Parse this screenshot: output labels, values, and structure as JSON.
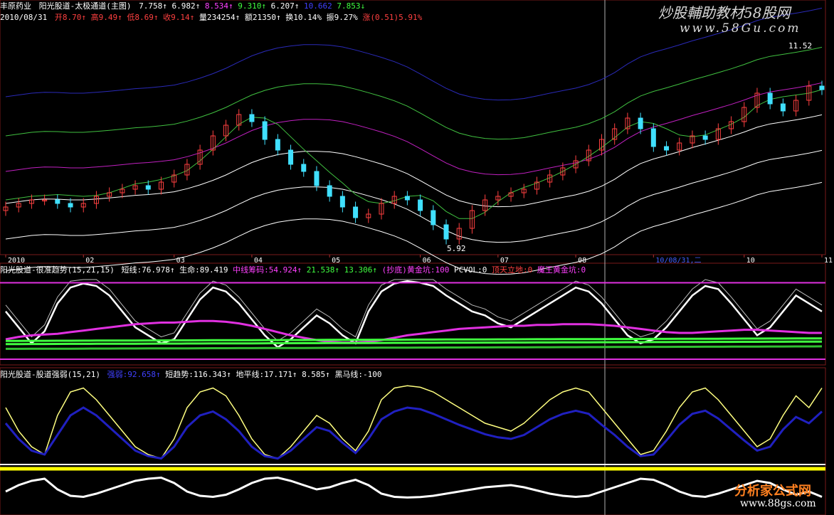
{
  "main_panel": {
    "stock_name": "丰原药业",
    "indicator_name": "阳光股道-太极通道(主图)",
    "indicator_values": [
      "7.758↑",
      "6.982↑",
      "8.534↑",
      "9.310↑",
      "6.207↑",
      "10.662",
      "7.853↓"
    ],
    "date_label": "2010/08/31",
    "ohlc": {
      "open": "开8.70↑",
      "high": "高9.49↑",
      "low": "低8.69↑",
      "close": "收9.14↑",
      "volume": "量234254↑",
      "amount": "额21350↑",
      "turnover": "换10.14%",
      "amplitude": "振9.27%",
      "change": "涨(0.51)5.91%"
    },
    "price_high_label": "11.52",
    "price_low_label": "5.92",
    "colors": {
      "up": "#ff4040",
      "down": "#40e0ff",
      "band_outer": "#2a2ab8",
      "band_mid": "#c020c0",
      "band_green": "#40c040",
      "band_white": "#ffffff"
    }
  },
  "time_axis": {
    "labels": [
      "2010",
      "02",
      "03",
      "04",
      "05",
      "06",
      "07",
      "08",
      "10/08/31,二",
      "10",
      "11"
    ]
  },
  "sub_panel_1": {
    "title": "阳光股道-很准趋势(15,21,15)",
    "items": [
      {
        "text": "短线:76.978↑",
        "color": "#ffffff"
      },
      {
        "text": "生命:89.419",
        "color": "#ffffff"
      },
      {
        "text": "中线筹码:54.924↑",
        "color": "#ff40ff"
      },
      {
        "text": "21.538↑",
        "color": "#40ff40"
      },
      {
        "text": "13.306↑",
        "color": "#40ff40"
      },
      {
        "text": "(抄底)黄金坑:100",
        "color": "#ff40ff"
      },
      {
        "text": "PCVOL:0",
        "color": "#ffffff"
      },
      {
        "text": "顶天立地:0",
        "color": "#ff4040"
      },
      {
        "text": "魔王黄金坑:0",
        "color": "#ff40ff"
      }
    ]
  },
  "sub_panel_2": {
    "title": "阳光股道-股道强弱(15,21)",
    "items": [
      {
        "text": "强弱:92.658↑",
        "color": "#4040ff"
      },
      {
        "text": "短趋势:116.343↑",
        "color": "#ffffff"
      },
      {
        "text": "地平线:17.171↑",
        "color": "#ffffff"
      },
      {
        "text": "8.585↑",
        "color": "#ffffff"
      },
      {
        "text": "黑马线:-100",
        "color": "#ffffff"
      }
    ]
  },
  "watermark": {
    "top_title": "炒股輔助教材58股网",
    "top_url": "www.58Gu.com",
    "bottom_brand": "分析家公式网",
    "bottom_url": "www.88gs.com"
  },
  "chart_data": {
    "type": "line",
    "approximate": true,
    "price_closes": [
      6.9,
      7.0,
      7.1,
      7.1,
      7.0,
      6.9,
      7.0,
      7.2,
      7.3,
      7.4,
      7.5,
      7.4,
      7.6,
      7.8,
      8.1,
      8.5,
      8.9,
      9.2,
      9.5,
      9.3,
      8.8,
      8.5,
      8.1,
      7.9,
      7.5,
      7.2,
      6.9,
      6.6,
      6.7,
      7.0,
      7.2,
      7.1,
      6.8,
      6.4,
      6.0,
      6.3,
      6.8,
      7.1,
      7.2,
      7.3,
      7.4,
      7.6,
      7.8,
      8.0,
      8.2,
      8.5,
      8.8,
      9.1,
      9.4,
      9.1,
      8.6,
      8.5,
      8.7,
      8.9,
      8.8,
      9.1,
      9.3,
      9.7,
      10.1,
      9.8,
      9.6,
      9.9,
      10.3,
      10.2
    ],
    "price_range": [
      5.92,
      11.52
    ],
    "sub1_short_line": [
      60,
      40,
      20,
      35,
      70,
      90,
      95,
      92,
      80,
      60,
      40,
      30,
      20,
      25,
      50,
      75,
      90,
      85,
      70,
      50,
      30,
      15,
      25,
      40,
      55,
      45,
      30,
      20,
      60,
      85,
      95,
      98,
      96,
      92,
      80,
      70,
      60,
      55,
      45,
      40,
      50,
      60,
      70,
      80,
      90,
      85,
      70,
      50,
      30,
      20,
      25,
      40,
      60,
      80,
      92,
      88,
      70,
      50,
      30,
      40,
      60,
      80,
      70,
      60
    ],
    "sub1_life_line": [
      25,
      28,
      30,
      31,
      32,
      34,
      36,
      38,
      40,
      42,
      44,
      45,
      46,
      46,
      47,
      48,
      48,
      47,
      45,
      42,
      38,
      34,
      30,
      27,
      24,
      22,
      21,
      21,
      22,
      24,
      27,
      30,
      32,
      34,
      36,
      38,
      39,
      40,
      41,
      42,
      42,
      43,
      43,
      44,
      44,
      44,
      43,
      42,
      40,
      38,
      36,
      34,
      33,
      33,
      34,
      35,
      36,
      37,
      37,
      36,
      35,
      34,
      33,
      33
    ],
    "sub2_yellow_line": [
      70,
      40,
      20,
      10,
      60,
      90,
      95,
      80,
      60,
      40,
      20,
      10,
      5,
      30,
      70,
      90,
      95,
      85,
      60,
      30,
      10,
      5,
      20,
      40,
      60,
      50,
      30,
      15,
      40,
      80,
      95,
      98,
      96,
      90,
      80,
      70,
      60,
      50,
      45,
      40,
      50,
      65,
      80,
      90,
      95,
      90,
      70,
      50,
      30,
      10,
      15,
      40,
      70,
      90,
      95,
      80,
      60,
      40,
      20,
      30,
      60,
      85,
      70,
      95
    ],
    "sub2_blue_line": [
      50,
      30,
      15,
      10,
      35,
      60,
      70,
      60,
      45,
      30,
      15,
      8,
      5,
      20,
      45,
      60,
      65,
      55,
      40,
      20,
      8,
      5,
      15,
      30,
      45,
      40,
      25,
      12,
      30,
      55,
      65,
      70,
      68,
      62,
      55,
      48,
      42,
      36,
      32,
      30,
      35,
      45,
      55,
      62,
      66,
      62,
      48,
      35,
      20,
      8,
      10,
      28,
      48,
      62,
      66,
      56,
      42,
      28,
      15,
      20,
      42,
      58,
      50,
      65
    ]
  }
}
